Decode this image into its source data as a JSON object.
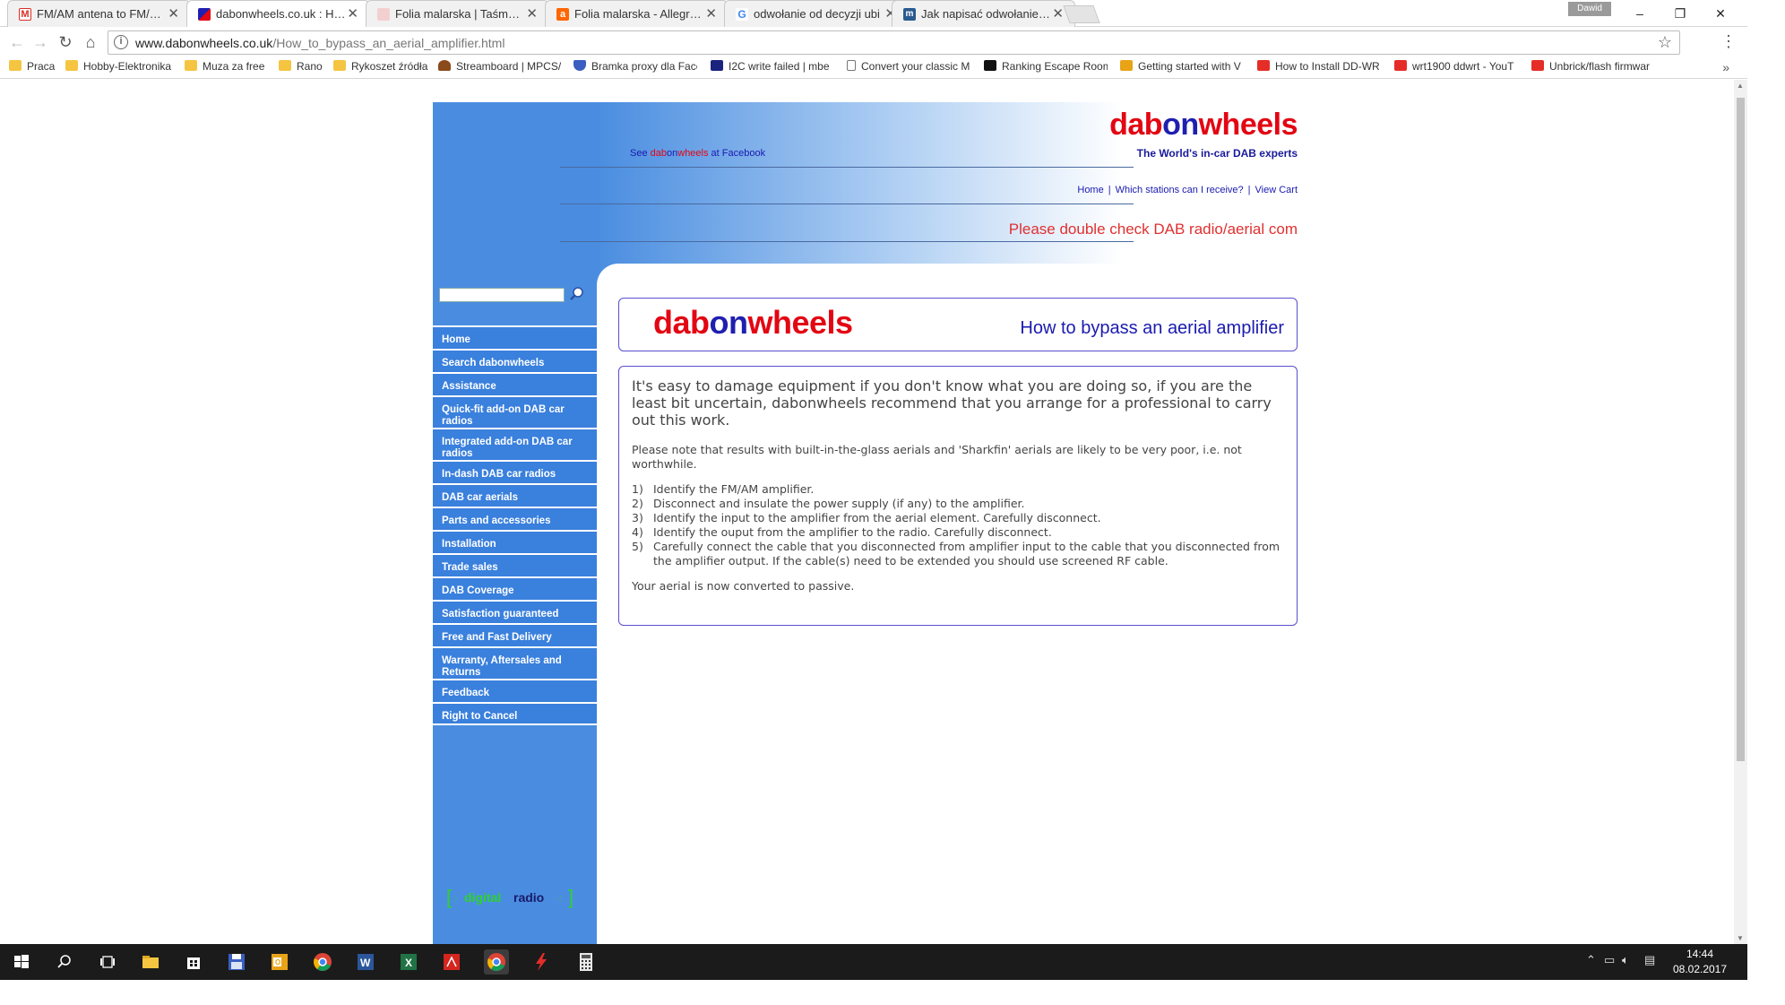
{
  "browser": {
    "tabs": [
      {
        "label": "FM/AM antena to FM/AM",
        "favicon_color": "#d93025"
      },
      {
        "label": "dabonwheels.co.uk : How",
        "favicon_color": "#1f1fb0"
      },
      {
        "label": "Folia malarska | Taśmy Fo",
        "favicon_color": "#e06060"
      },
      {
        "label": "Folia malarska - Allegro.p",
        "favicon_color": "#ff6600"
      },
      {
        "label": "odwołanie od decyzji ubi",
        "favicon_color": "#4285f4"
      },
      {
        "label": "Jak napisać odwołanie od",
        "favicon_color": "#2a5a90"
      }
    ],
    "user_badge": "Dawid",
    "window_controls": {
      "minimize": "–",
      "restore": "❐",
      "close": "✕"
    },
    "url_host": "www.dabonwheels.co.uk",
    "url_path": "/How_to_bypass_an_aerial_amplifier.html",
    "bookmarks": [
      {
        "label": "Praca",
        "icon": "folder-icon",
        "color": "#f5c542"
      },
      {
        "label": "Hobby-Elektronika",
        "icon": "folder-icon",
        "color": "#f5c542"
      },
      {
        "label": "Muza za free",
        "icon": "folder-icon",
        "color": "#f5c542"
      },
      {
        "label": "Rano",
        "icon": "folder-icon",
        "color": "#f5c542"
      },
      {
        "label": "Rykoszet źródła",
        "icon": "folder-icon",
        "color": "#f5c542"
      },
      {
        "label": "Streamboard | MPCS/",
        "icon": "site-icon",
        "color": "#8a4a1a"
      },
      {
        "label": "Bramka proxy dla Face",
        "icon": "shield-icon",
        "color": "#3a5fc0"
      },
      {
        "label": "I2C write failed | mbe",
        "icon": "site-icon",
        "color": "#1a237e"
      },
      {
        "label": "Convert your classic M",
        "icon": "page-icon",
        "color": "#ffffff"
      },
      {
        "label": "Ranking Escape Room",
        "icon": "site-icon",
        "color": "#111111"
      },
      {
        "label": "Getting started with V",
        "icon": "site-icon",
        "color": "#e8a317"
      },
      {
        "label": "How to Install DD-WR",
        "icon": "youtube-icon",
        "color": "#e52d27"
      },
      {
        "label": "wrt1900 ddwrt - YouT",
        "icon": "youtube-icon",
        "color": "#e52d27"
      },
      {
        "label": "Unbrick/flash firmwar",
        "icon": "youtube-icon",
        "color": "#e52d27"
      }
    ],
    "bookmarks_overflow": "»"
  },
  "site": {
    "brand": {
      "dab": "dab",
      "on": "on",
      "wheels": "wheels"
    },
    "tagline": "The World's in-car DAB experts",
    "facebook": {
      "prefix": "See ",
      "suffix": " at Facebook"
    },
    "header_nav": [
      "Home",
      "Which stations can I receive?",
      "View Cart"
    ],
    "header_nav_sep": "|",
    "ticker": "Please double check DAB radio/aerial com",
    "search": {
      "value": ""
    },
    "menu": [
      "Home",
      "Search dabonwheels",
      "Assistance",
      "Quick-fit add-on DAB car radios",
      "Integrated add-on DAB car radios",
      "In-dash DAB car radios",
      "DAB car aerials",
      "Parts and accessories",
      "Installation",
      "Trade sales",
      "DAB Coverage",
      "Satisfaction guaranteed",
      "Free and Fast Delivery",
      "Warranty, Aftersales and Returns",
      "Feedback",
      "Right to Cancel"
    ],
    "digital_radio_logo": {
      "prefix": "digital",
      "suffix": "radio"
    }
  },
  "article": {
    "title": "How to bypass an aerial amplifier",
    "intro": "It's easy to damage equipment if you don't know what you are doing so, if you are the least bit uncertain, dabonwheels recommend that you arrange for a professional to carry out this work.",
    "note": "Please note that results with built-in-the-glass aerials and 'Sharkfin' aerials are likely to be very poor, i.e. not worthwhile.",
    "steps": [
      {
        "num": "1)",
        "text": "Identify the FM/AM amplifier."
      },
      {
        "num": "2)",
        "text": "Disconnect and insulate the power supply (if any) to the amplifier."
      },
      {
        "num": "3)",
        "text": "Identify the input to the amplifier from the aerial element.  Carefully disconnect."
      },
      {
        "num": "4)",
        "text": "Identify the ouput from the amplifier to the radio.  Carefully disconnect."
      },
      {
        "num": "5)",
        "text": "Carefully connect the cable that you disconnected from amplifier input to the cable that you disconnected from the amplifier output.  If the cable(s) need to be extended you should use screened RF cable."
      }
    ],
    "outro": "Your aerial is now converted to passive."
  },
  "taskbar": {
    "time": "14:44",
    "date": "08.02.2017",
    "apps": [
      "windows-start-icon",
      "search-icon",
      "task-view-icon",
      "file-explorer-icon",
      "store-icon",
      "save-app-icon",
      "outlook-icon",
      "chrome-icon",
      "word-icon",
      "excel-icon",
      "acrobat-icon",
      "chrome-icon",
      "flash-app-icon",
      "calculator-icon"
    ]
  },
  "colors": {
    "brand_red": "#e30613",
    "brand_blue": "#1f1fb0",
    "sidebar_blue": "#3a80dd",
    "box_border": "#5a4fcf"
  }
}
